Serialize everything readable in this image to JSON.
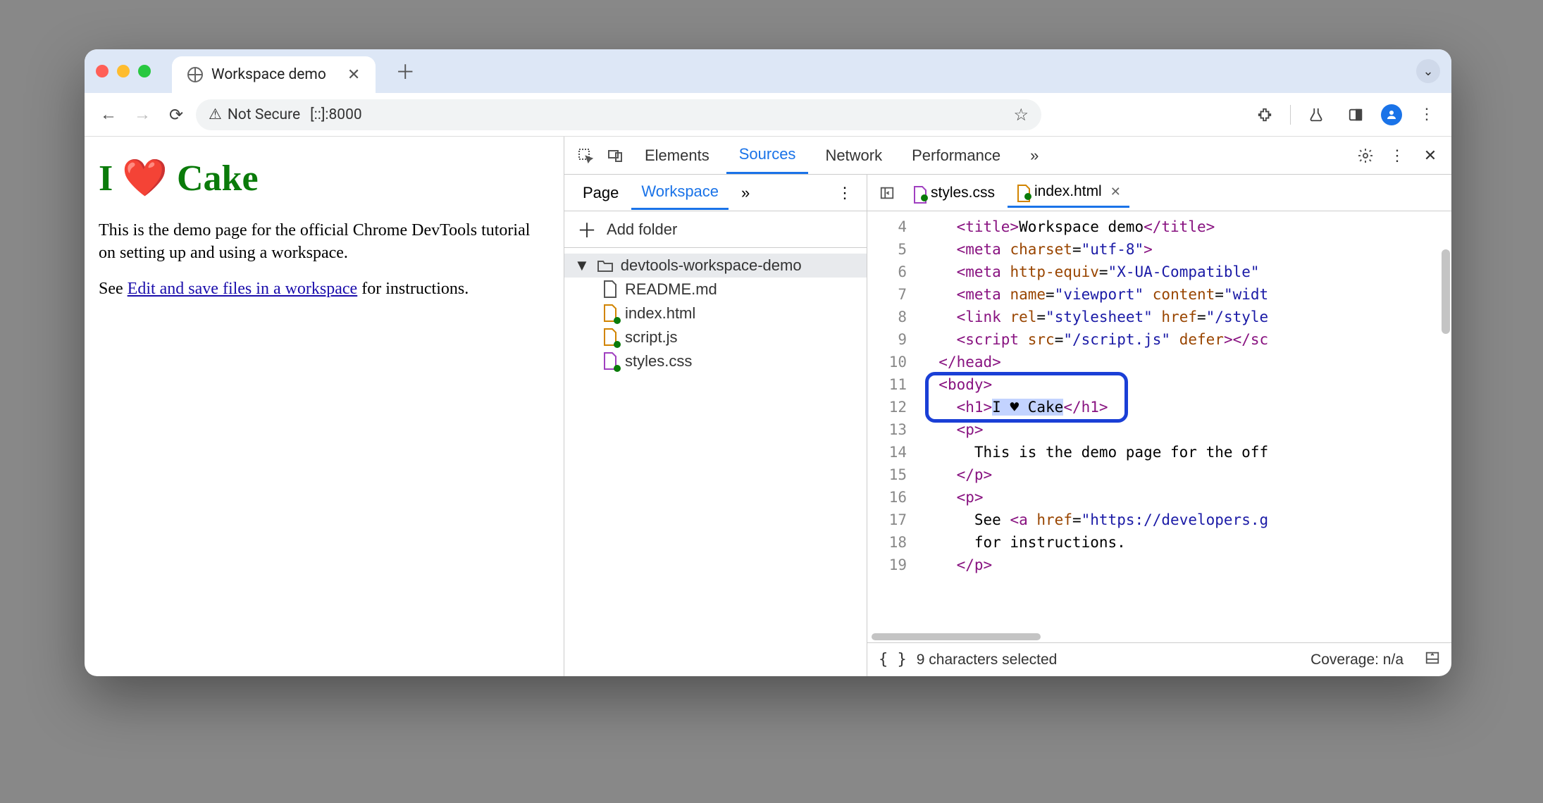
{
  "browser": {
    "tab_title": "Workspace demo",
    "omnibox_security": "Not Secure",
    "omnibox_url": "[::]:8000"
  },
  "page": {
    "h1_html": "I ❤️ Cake",
    "p1": "This is the demo page for the official Chrome DevTools tutorial on setting up and using a workspace.",
    "p2_before": "See ",
    "p2_link": "Edit and save files in a workspace",
    "p2_after": " for instructions."
  },
  "devtools": {
    "tabs": {
      "elements": "Elements",
      "sources": "Sources",
      "network": "Network",
      "performance": "Performance",
      "more": "»"
    },
    "active_tab": "Sources",
    "nav": {
      "tabs": {
        "page": "Page",
        "workspace": "Workspace",
        "more": "»"
      },
      "active": "Workspace",
      "add_folder": "Add folder",
      "tree": {
        "folder": "devtools-workspace-demo",
        "files": [
          "README.md",
          "index.html",
          "script.js",
          "styles.css"
        ]
      }
    },
    "editor": {
      "tabs": [
        {
          "name": "styles.css",
          "active": false
        },
        {
          "name": "index.html",
          "active": true
        }
      ],
      "gutter": [
        "4",
        "5",
        "6",
        "7",
        "8",
        "9",
        "10",
        "11",
        "12",
        "13",
        "14",
        "15",
        "16",
        "17",
        "18",
        "19"
      ]
    },
    "status": {
      "selection": "9 characters selected",
      "coverage": "Coverage: n/a"
    }
  }
}
